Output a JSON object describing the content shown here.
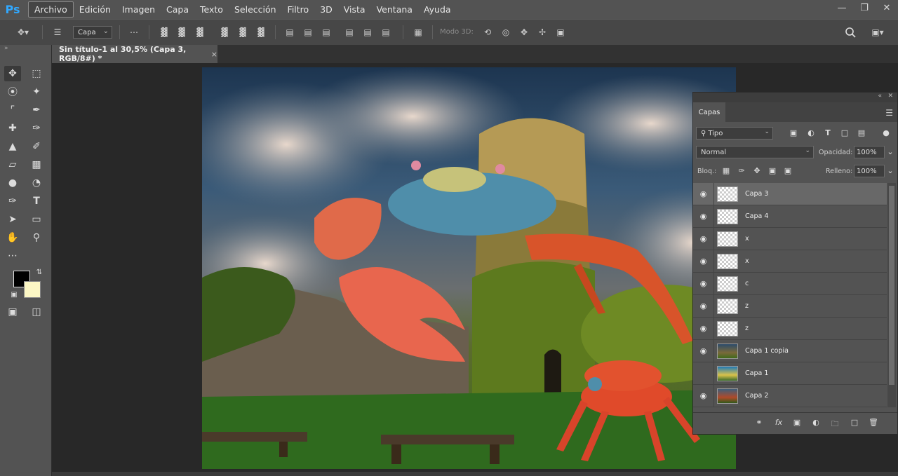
{
  "app": {
    "logo": "Ps"
  },
  "menubar": {
    "items": [
      "Archivo",
      "Edición",
      "Imagen",
      "Capa",
      "Texto",
      "Selección",
      "Filtro",
      "3D",
      "Vista",
      "Ventana",
      "Ayuda"
    ],
    "window_controls": [
      "minimize-icon",
      "restore-icon",
      "close-icon"
    ]
  },
  "options_bar": {
    "auto_select_value": "Capa",
    "mode_3d_label": "Modo 3D:"
  },
  "document_tab": {
    "title": "Sin título-1 al 30,5% (Capa 3, RGB/8#) *",
    "close": "×"
  },
  "toolbar": {
    "tools": [
      "move-icon",
      "marquee-icon",
      "lasso-icon",
      "magic-wand-icon",
      "crop-icon",
      "eyedropper-icon",
      "healing-brush-icon",
      "brush-icon",
      "clone-stamp-icon",
      "history-brush-icon",
      "eraser-icon",
      "gradient-icon",
      "blur-icon",
      "dodge-icon",
      "pen-icon",
      "type-icon",
      "path-selection-icon",
      "rectangle-icon",
      "hand-icon",
      "zoom-icon",
      "more-tools-icon"
    ],
    "foreground_color": "#000000",
    "background_color": "#fcf7c4"
  },
  "layers_panel": {
    "tab_label": "Capas",
    "filter_select": "Tipo",
    "blend_mode": "Normal",
    "opacity_label": "Opacidad:",
    "opacity_value": "100%",
    "lock_label": "Bloq.:",
    "fill_label": "Relleno:",
    "fill_value": "100%",
    "layers": [
      {
        "name": "Capa 3",
        "visible": true,
        "selected": true
      },
      {
        "name": "Capa 4",
        "visible": true,
        "selected": false
      },
      {
        "name": "x",
        "visible": true,
        "selected": false
      },
      {
        "name": "x",
        "visible": true,
        "selected": false
      },
      {
        "name": "c",
        "visible": true,
        "selected": false
      },
      {
        "name": "z",
        "visible": true,
        "selected": false
      },
      {
        "name": "z",
        "visible": true,
        "selected": false
      },
      {
        "name": "Capa 1 copia",
        "visible": true,
        "selected": false
      },
      {
        "name": "Capa 1",
        "visible": false,
        "selected": false
      },
      {
        "name": "Capa 2",
        "visible": true,
        "selected": false
      }
    ]
  },
  "colors": {
    "menubar_bg": "#535353",
    "panel_bg": "#535353",
    "canvas_bg": "#282828",
    "accent_ps": "#31a8ff"
  }
}
